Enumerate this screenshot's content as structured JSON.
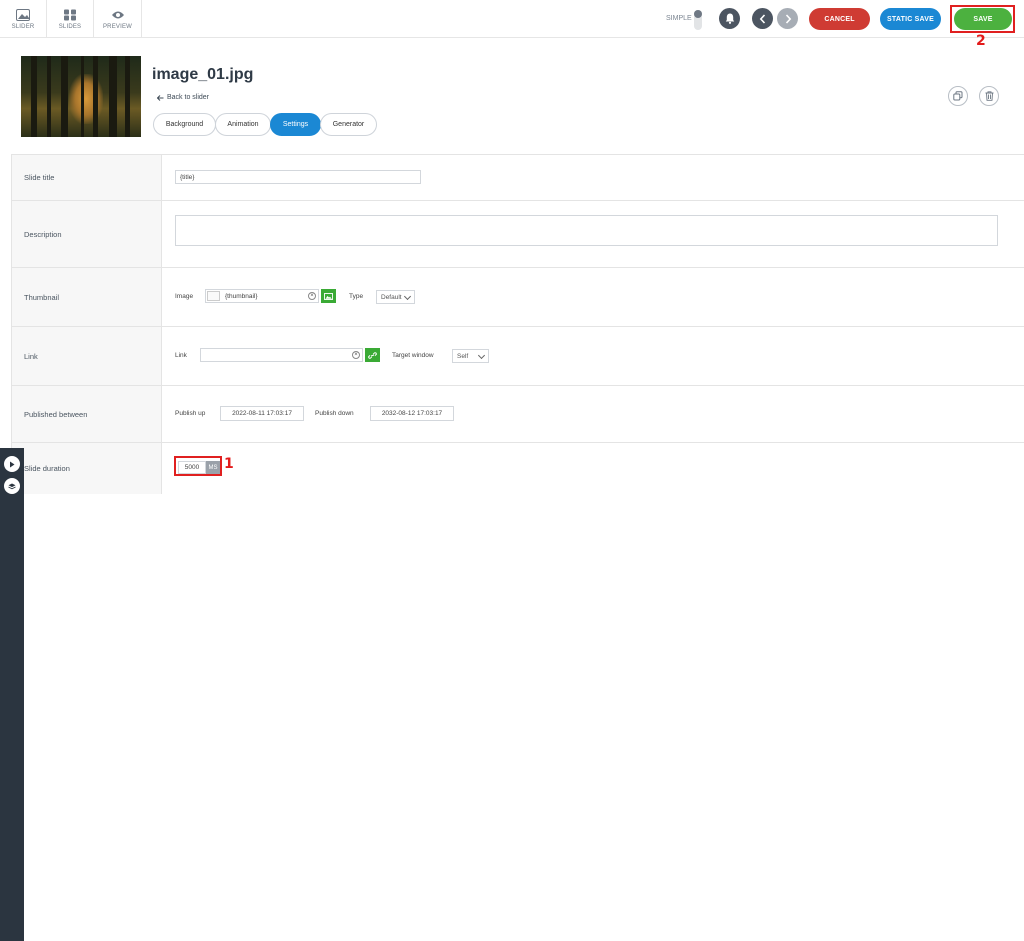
{
  "topnav": [
    {
      "label": "SLIDER",
      "icon": "image-icon"
    },
    {
      "label": "SLIDES",
      "icon": "grid-icon"
    },
    {
      "label": "PREVIEW",
      "icon": "eye-icon"
    }
  ],
  "toolbar": {
    "simple_label": "SIMPLE",
    "cancel_label": "CANCEL",
    "static_save_label": "STATIC SAVE",
    "save_label": "SAVE"
  },
  "annotations": {
    "save_marker": "2",
    "duration_marker": "1"
  },
  "slide": {
    "title": "image_01.jpg",
    "back_label": "Back to slider",
    "tabs": [
      "Background",
      "Animation",
      "Settings",
      "Generator"
    ],
    "active_tab": "Settings"
  },
  "form": {
    "slide_title": {
      "label": "Slide title",
      "value": "{title}"
    },
    "description": {
      "label": "Description",
      "value": ""
    },
    "thumbnail": {
      "label": "Thumbnail",
      "image_label": "Image",
      "image_value": "{thumbnail}",
      "type_label": "Type",
      "type_value": "Default"
    },
    "link": {
      "label": "Link",
      "link_label": "Link",
      "link_value": "",
      "target_label": "Target window",
      "target_value": "Self"
    },
    "published": {
      "label": "Published between",
      "up_label": "Publish up",
      "up_value": "2022-08-11 17:03:17",
      "down_label": "Publish down",
      "down_value": "2032-08-12 17:03:17"
    },
    "duration": {
      "label": "Slide duration",
      "value": "5000",
      "unit": "MS"
    }
  },
  "colors": {
    "cancel": "#cf3b33",
    "static_save": "#1b88d4",
    "save": "#4cb13f",
    "active_tab": "#1b88d4"
  }
}
